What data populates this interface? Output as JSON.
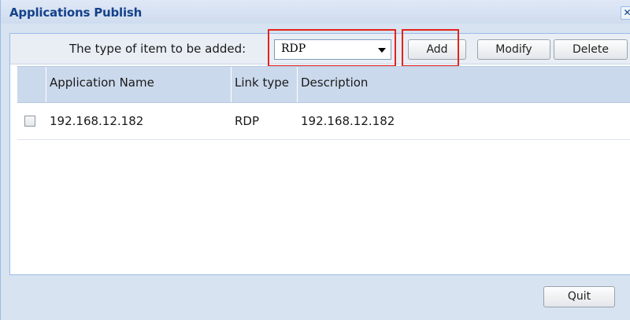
{
  "window": {
    "title": "Applications Publish",
    "close_glyph": "✕",
    "close_icon": "close-icon"
  },
  "toolbar": {
    "type_label": "The type of item to be added:",
    "type_select": {
      "value": "RDP",
      "icon": "chevron-down-icon"
    },
    "add_label": "Add",
    "modify_label": "Modify",
    "delete_label": "Delete"
  },
  "grid": {
    "columns": [
      "",
      "Application Name",
      "Link type",
      "Description"
    ],
    "rows": [
      {
        "checked": false,
        "name": "192.168.12.182",
        "link_type": "RDP",
        "description": "192.168.12.182"
      }
    ]
  },
  "footer": {
    "quit_label": "Quit"
  },
  "colors": {
    "title": "#15428b",
    "highlight": "#e3231b",
    "header_bg": "#cbd9ec",
    "dialog_bg": "#d7e3f1"
  }
}
